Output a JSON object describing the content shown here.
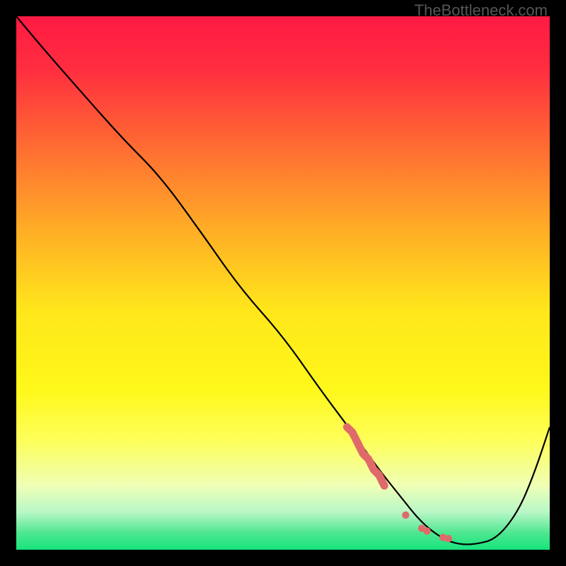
{
  "watermark": "TheBottleneck.com",
  "chart_data": {
    "type": "line",
    "title": "",
    "xlabel": "",
    "ylabel": "",
    "xlim": [
      0,
      100
    ],
    "ylim": [
      0,
      100
    ],
    "background_gradient": {
      "stops": [
        {
          "pos": 0.0,
          "color": "#ff1a44"
        },
        {
          "pos": 0.1,
          "color": "#ff2e3f"
        },
        {
          "pos": 0.25,
          "color": "#ff6e32"
        },
        {
          "pos": 0.4,
          "color": "#ffad26"
        },
        {
          "pos": 0.55,
          "color": "#ffe61b"
        },
        {
          "pos": 0.7,
          "color": "#fff81a"
        },
        {
          "pos": 0.8,
          "color": "#fdff5e"
        },
        {
          "pos": 0.88,
          "color": "#efffb6"
        },
        {
          "pos": 0.93,
          "color": "#b7f7c6"
        },
        {
          "pos": 0.97,
          "color": "#4be68e"
        },
        {
          "pos": 1.0,
          "color": "#17e37d"
        }
      ]
    },
    "series": [
      {
        "name": "bottleneck-curve",
        "color": "#000000",
        "x": [
          0,
          5,
          12,
          20,
          27,
          35,
          42,
          50,
          57,
          63,
          68,
          72,
          76,
          80,
          83,
          86,
          90,
          94,
          97,
          100
        ],
        "y": [
          100,
          94,
          86,
          77,
          70,
          59,
          49,
          40,
          30,
          22,
          15,
          10,
          5,
          2,
          1,
          1,
          2,
          7,
          14,
          23
        ]
      }
    ],
    "highlight_segment": {
      "name": "highlighted-range",
      "color": "#e06a6a",
      "points": [
        {
          "x": 62,
          "y": 23
        },
        {
          "x": 63,
          "y": 22
        },
        {
          "x": 64,
          "y": 20
        },
        {
          "x": 65,
          "y": 18
        },
        {
          "x": 66,
          "y": 17
        },
        {
          "x": 67,
          "y": 15
        },
        {
          "x": 68,
          "y": 14
        },
        {
          "x": 69,
          "y": 12
        }
      ],
      "dots": [
        {
          "x": 73,
          "y": 6.5
        },
        {
          "x": 76,
          "y": 4.0
        },
        {
          "x": 77,
          "y": 3.5
        },
        {
          "x": 80,
          "y": 2.3
        },
        {
          "x": 81,
          "y": 2.1
        }
      ]
    }
  }
}
